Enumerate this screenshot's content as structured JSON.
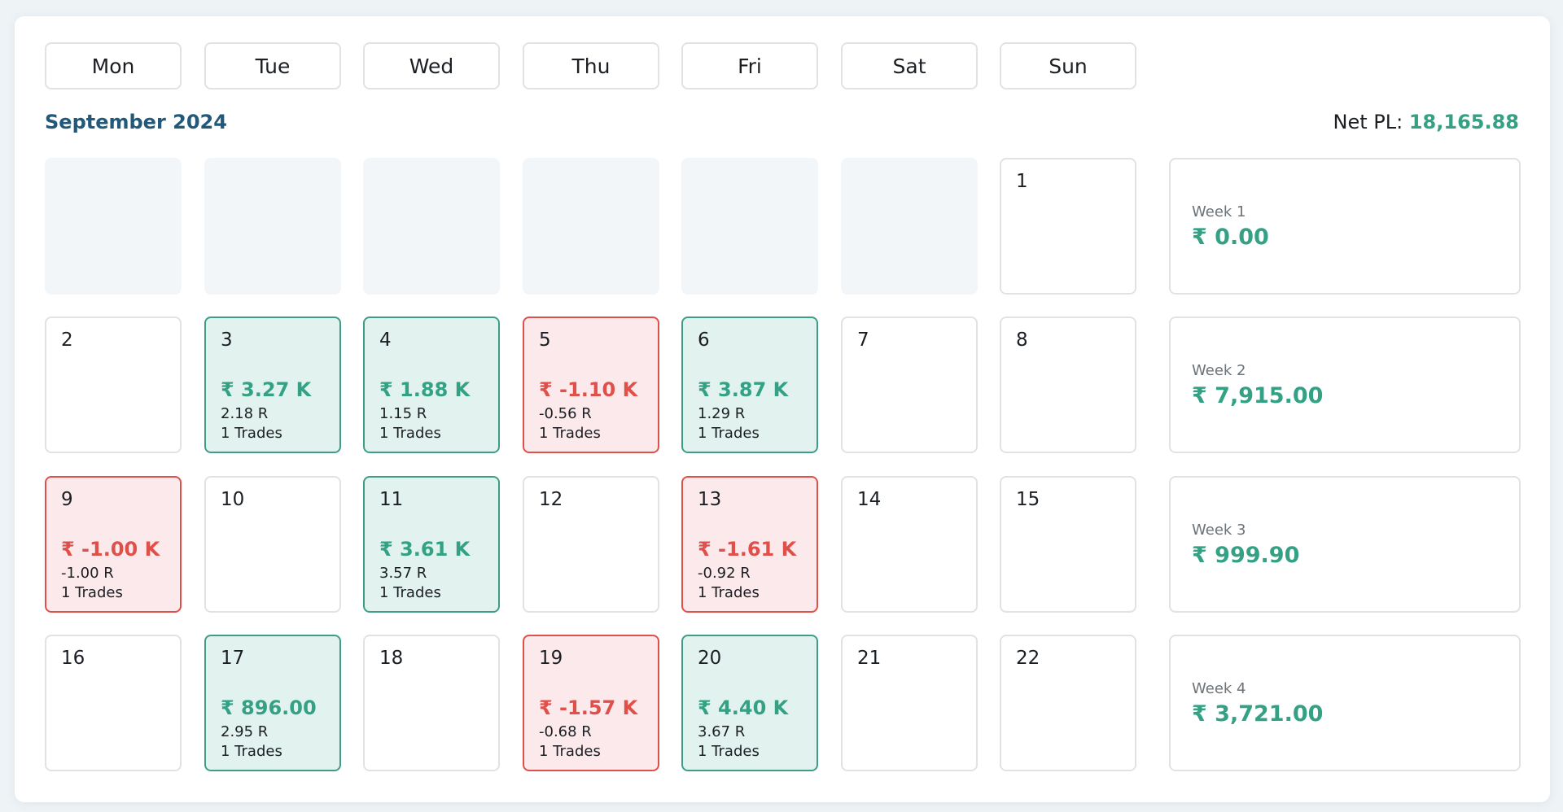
{
  "weekdays": [
    "Mon",
    "Tue",
    "Wed",
    "Thu",
    "Fri",
    "Sat",
    "Sun"
  ],
  "month_title": "September 2024",
  "net_pl": {
    "label": "Net PL: ",
    "value": "18,165.88"
  },
  "weeks": [
    {
      "label": "Week 1",
      "value": "₹ 0.00",
      "days": [
        {
          "empty": true
        },
        {
          "empty": true
        },
        {
          "empty": true
        },
        {
          "empty": true
        },
        {
          "empty": true
        },
        {
          "empty": true
        },
        {
          "day": "1"
        }
      ]
    },
    {
      "label": "Week 2",
      "value": "₹ 7,915.00",
      "days": [
        {
          "day": "2"
        },
        {
          "day": "3",
          "status": "win",
          "amount": "₹ 3.27 K",
          "r": "2.18 R",
          "trades": "1 Trades"
        },
        {
          "day": "4",
          "status": "win",
          "amount": "₹ 1.88 K",
          "r": "1.15 R",
          "trades": "1 Trades"
        },
        {
          "day": "5",
          "status": "loss",
          "amount": "₹ -1.10 K",
          "r": "-0.56 R",
          "trades": "1 Trades"
        },
        {
          "day": "6",
          "status": "win",
          "amount": "₹ 3.87 K",
          "r": "1.29 R",
          "trades": "1 Trades"
        },
        {
          "day": "7"
        },
        {
          "day": "8"
        }
      ]
    },
    {
      "label": "Week 3",
      "value": "₹ 999.90",
      "days": [
        {
          "day": "9",
          "status": "loss",
          "amount": "₹ -1.00 K",
          "r": "-1.00 R",
          "trades": "1 Trades"
        },
        {
          "day": "10"
        },
        {
          "day": "11",
          "status": "win",
          "amount": "₹ 3.61 K",
          "r": "3.57 R",
          "trades": "1 Trades"
        },
        {
          "day": "12"
        },
        {
          "day": "13",
          "status": "loss",
          "amount": "₹ -1.61 K",
          "r": "-0.92 R",
          "trades": "1 Trades"
        },
        {
          "day": "14"
        },
        {
          "day": "15"
        }
      ]
    },
    {
      "label": "Week 4",
      "value": "₹ 3,721.00",
      "days": [
        {
          "day": "16"
        },
        {
          "day": "17",
          "status": "win",
          "amount": "₹ 896.00",
          "r": "2.95 R",
          "trades": "1 Trades"
        },
        {
          "day": "18"
        },
        {
          "day": "19",
          "status": "loss",
          "amount": "₹ -1.57 K",
          "r": "-0.68 R",
          "trades": "1 Trades"
        },
        {
          "day": "20",
          "status": "win",
          "amount": "₹ 4.40 K",
          "r": "3.67 R",
          "trades": "1 Trades"
        },
        {
          "day": "21"
        },
        {
          "day": "22"
        }
      ]
    }
  ],
  "colors": {
    "profit": "#34a185",
    "loss": "#e0504a",
    "title": "#22587a"
  }
}
